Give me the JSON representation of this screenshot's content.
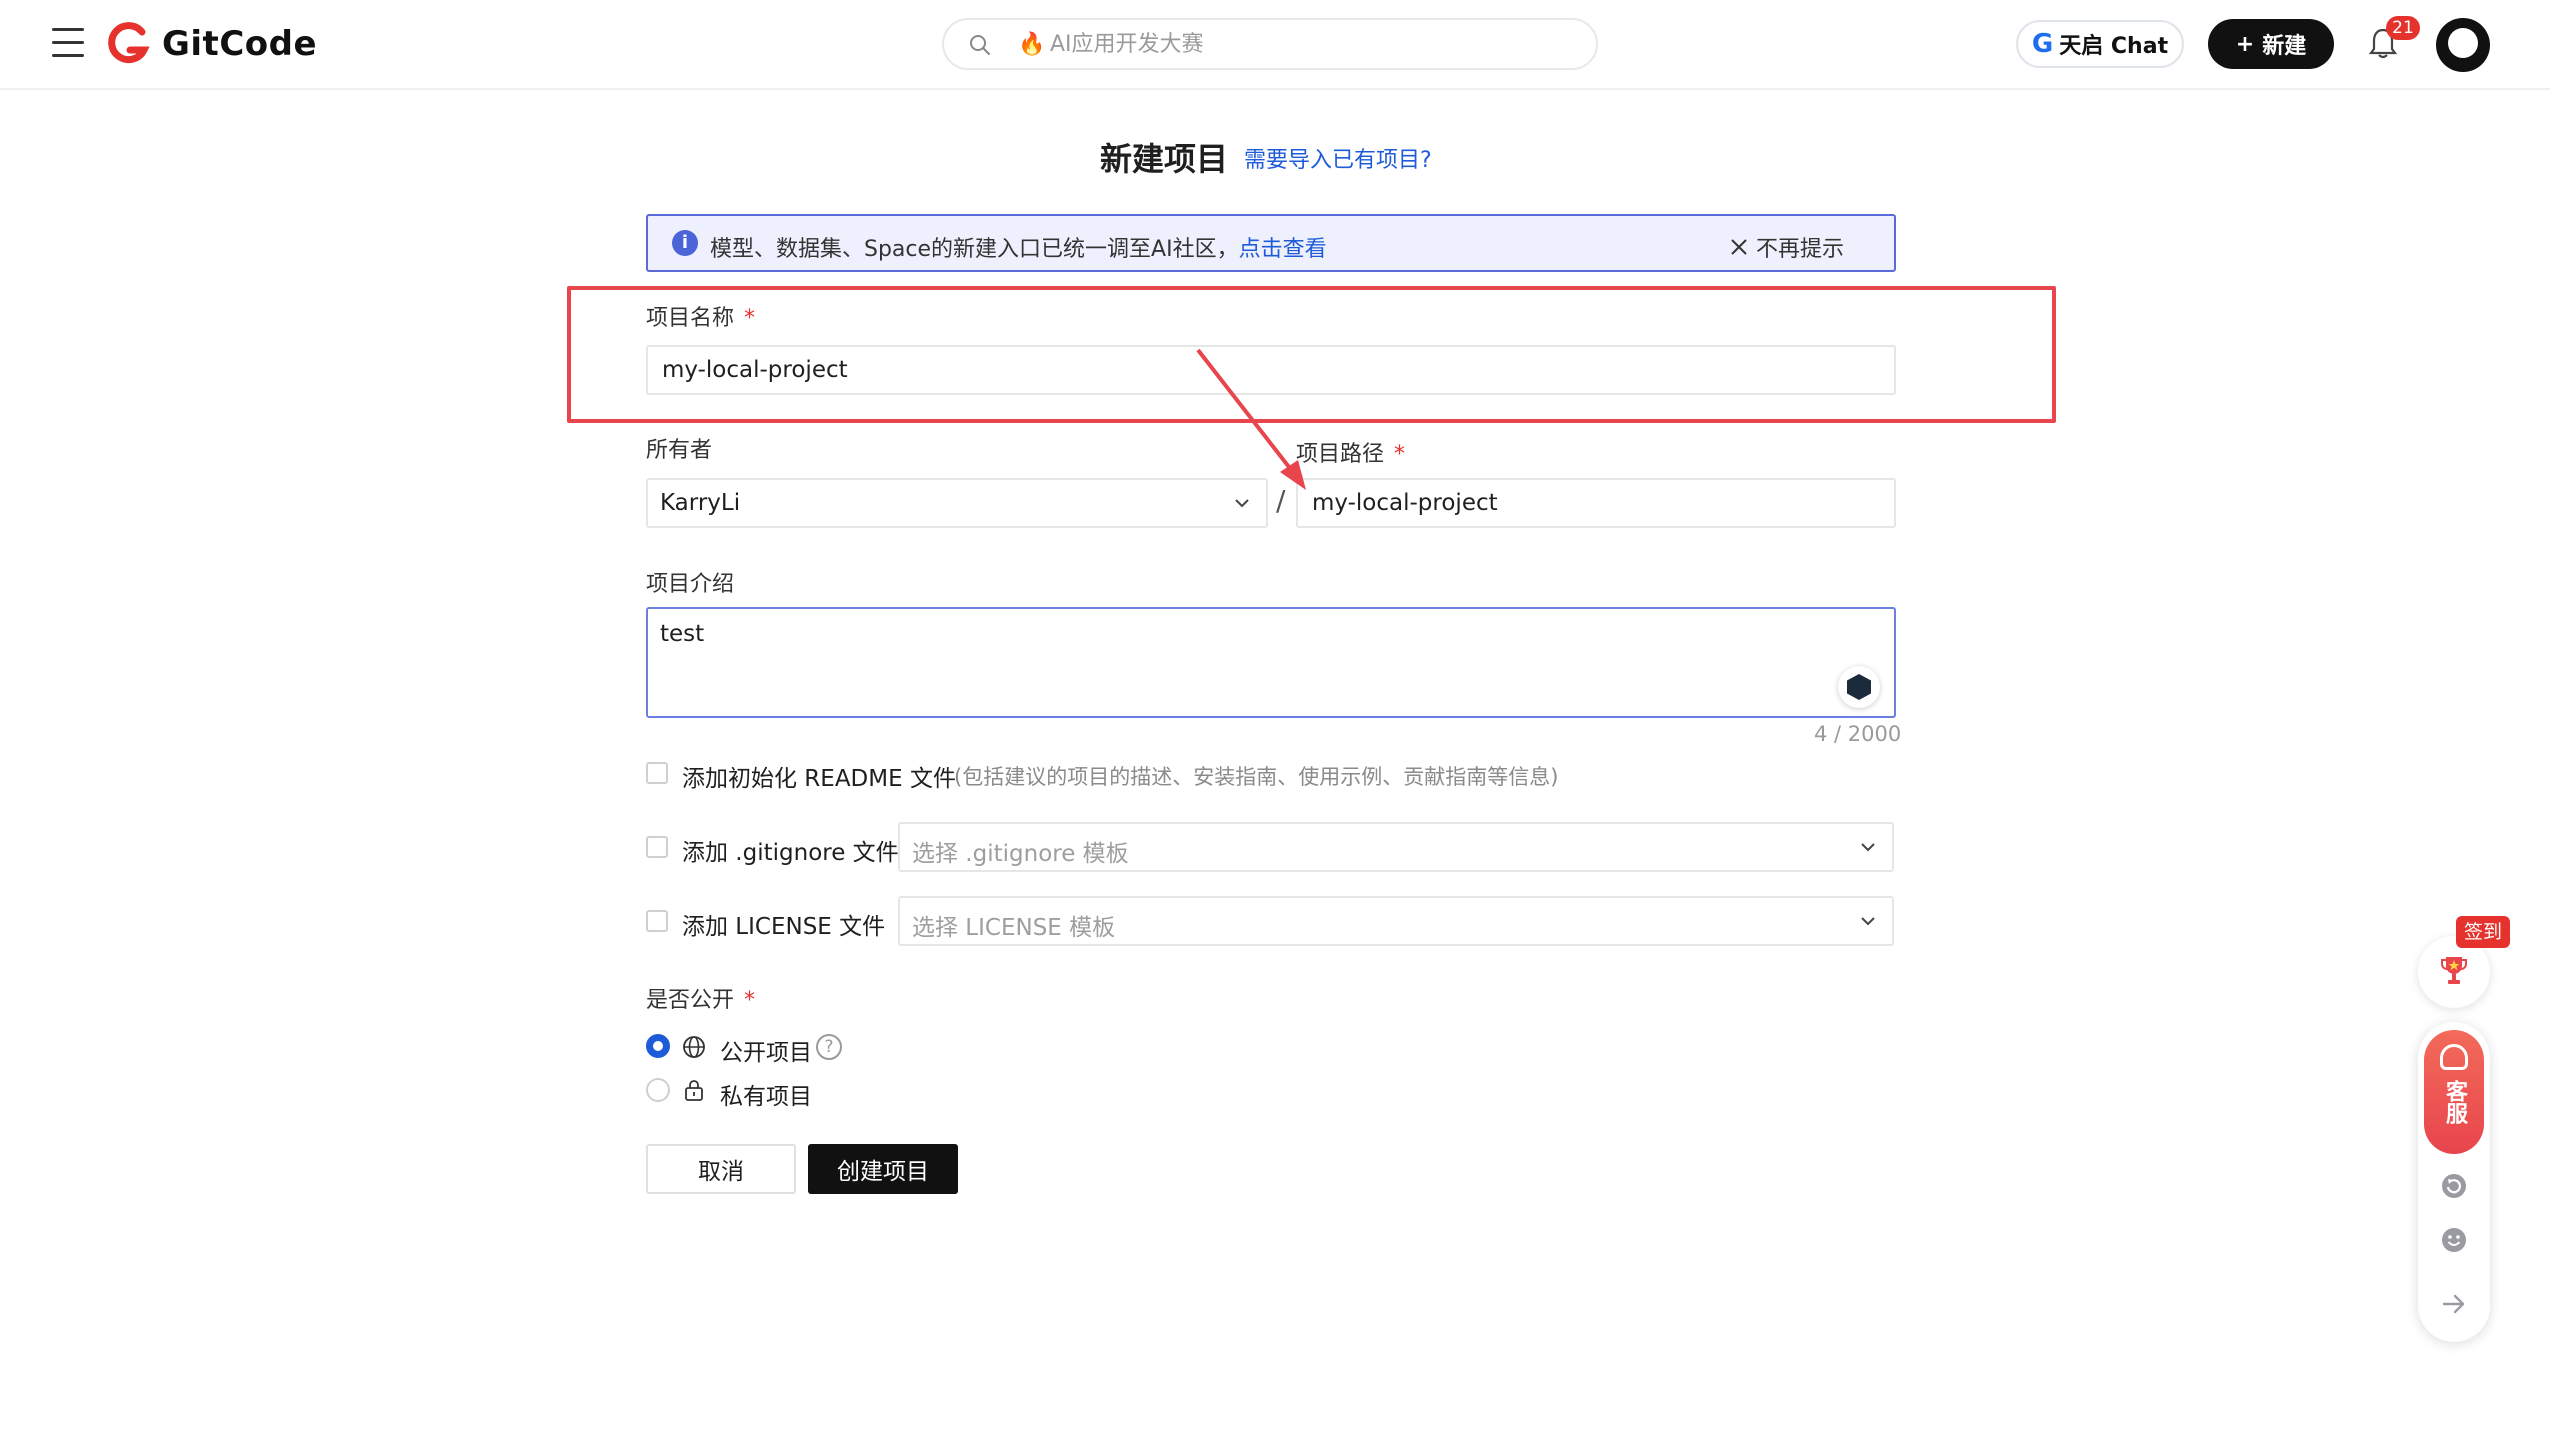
{
  "nav": {
    "brand": "GitCode",
    "search_placeholder": "AI应用开发大赛",
    "chat_label": "天启 Chat",
    "new_label": "新建",
    "notification_count": "21"
  },
  "page": {
    "title": "新建项目",
    "import_link": "需要导入已有项目?"
  },
  "banner": {
    "message": "模型、数据集、Space的新建入口已统一调至AI社区，",
    "link": "点击查看",
    "dismiss": "不再提示"
  },
  "form": {
    "project_name_label": "项目名称",
    "project_name_value": "my-local-project",
    "owner_label": "所有者",
    "owner_value": "KarryLi",
    "separator": "/",
    "path_label": "项目路径",
    "path_value": "my-local-project",
    "required_mark": "*",
    "description_label": "项目介绍",
    "description_value": "test",
    "char_counter": "4 / 2000",
    "readme_label": "添加初始化 README 文件",
    "readme_hint": "(包括建议的项目的描述、安装指南、使用示例、贡献指南等信息)",
    "gitignore_label": "添加 .gitignore 文件",
    "gitignore_placeholder": "选择 .gitignore 模板",
    "license_label": "添加 LICENSE 文件",
    "license_placeholder": "选择 LICENSE 模板",
    "visibility_label": "是否公开",
    "public_label": "公开项目",
    "private_label": "私有项目",
    "cancel_label": "取消",
    "create_label": "创建项目"
  },
  "side": {
    "sign_in": "签到",
    "support": "客服"
  },
  "colors": {
    "accent": "#1e5bd8",
    "highlight": "#e8454d",
    "primary_button": "#111111"
  }
}
